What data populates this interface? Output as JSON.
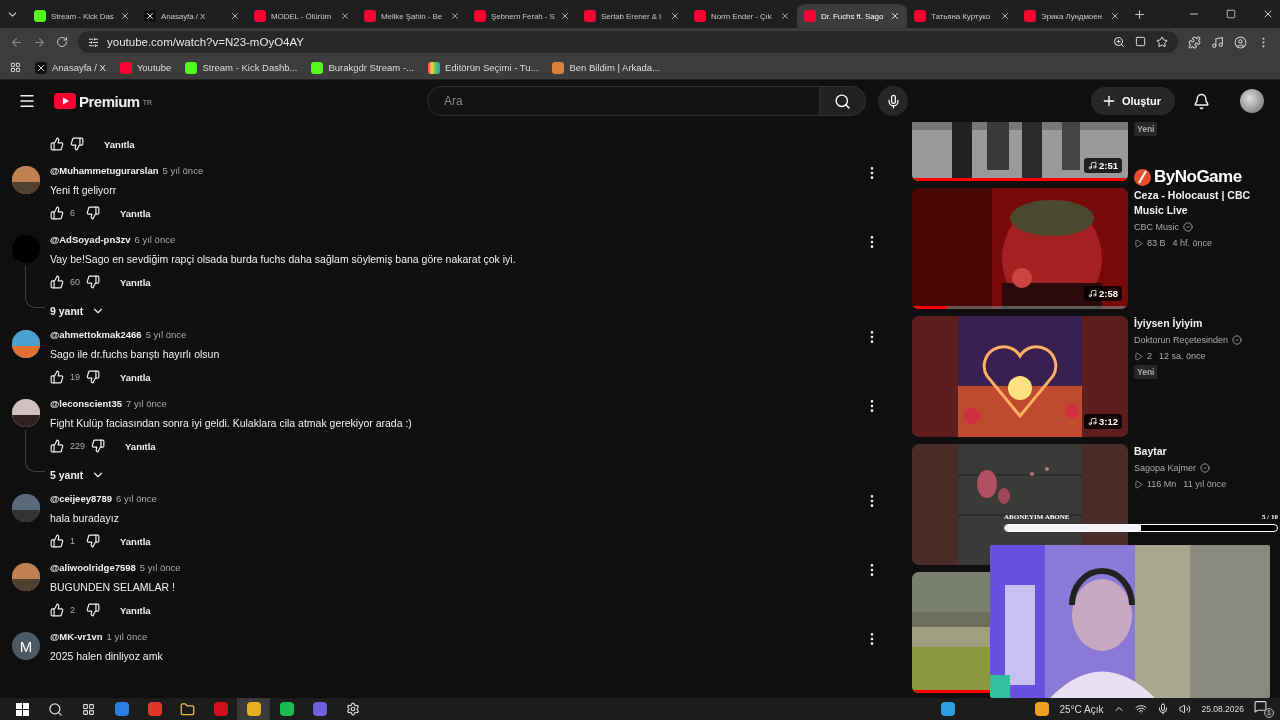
{
  "browser": {
    "tabs": [
      {
        "title": "Stream - Kick Das",
        "selected": false
      },
      {
        "title": "Anasayfa / X",
        "selected": false
      },
      {
        "title": "MODEL - Ölürüm",
        "selected": false
      },
      {
        "title": "Melike Şahin - Be",
        "selected": false
      },
      {
        "title": "Şebnem Ferah - S",
        "selected": false
      },
      {
        "title": "Sertab Erener & I",
        "selected": false
      },
      {
        "title": "Norm Ender - Çık",
        "selected": false
      },
      {
        "title": "Dr. Fuchs ft. Sago",
        "selected": true
      },
      {
        "title": "Татьяна Куртуко",
        "selected": false
      },
      {
        "title": "Эрика Лундмоен",
        "selected": false
      }
    ],
    "url": "youtube.com/watch?v=N23-mOyO4AY",
    "bookmarks": [
      "Anasayfa / X",
      "Youtube",
      "Stream - Kick Dashb...",
      "Burakgdr Stream -...",
      "Editörün Seçimi - Tu...",
      "Ben Bildim | Arkada..."
    ]
  },
  "header": {
    "logo": "Premium",
    "region": "TR",
    "search": {
      "placeholder": "Ara"
    },
    "create_button": "Oluştur"
  },
  "comments": [
    {
      "kind": "cut",
      "reply_button": "Yanıtla"
    },
    {
      "kind": "full",
      "author": "@Muhammetugurarslan",
      "time": "5 yıl önce",
      "text": "Yeni ft geliyorr",
      "likes": "6",
      "reply_button": "Yanıtla"
    },
    {
      "kind": "full",
      "avatar": {
        "kind": "blank"
      },
      "author": "@AdSoyad-pn3zv",
      "time": "6 yıl önce",
      "text": "Vay be!Sago en sevdiğim rapçi olsada burda fuchs daha sağlam söylemiş bana göre  nakarat çok iyi.",
      "likes": "60",
      "reply_button": "Yanıtla",
      "replies": "9 yanıt"
    },
    {
      "kind": "full",
      "author": "@ahmettokmak2466",
      "time": "5 yıl önce",
      "text": "Sago ile dr.fuchs barıştı hayırlı olsun",
      "likes": "19",
      "reply_button": "Yanıtla"
    },
    {
      "kind": "full",
      "author": "@leconscient35",
      "time": "7 yıl önce",
      "text": "Fight Kulüp faciasından sonra iyi geldi. Kulaklara cila atmak gerekiyor arada :)",
      "likes": "229",
      "reply_button": "Yanıtla",
      "replies": "5 yanıt"
    },
    {
      "kind": "full",
      "author": "@ceijeey8789",
      "time": "6 yıl önce",
      "text": "hala buradayız",
      "likes": "1",
      "reply_button": "Yanıtla"
    },
    {
      "kind": "full",
      "author": "@aliwoolridge7598",
      "time": "5 yıl önce",
      "text": "BUGUNDEN SELAMLAR !",
      "likes": "2",
      "reply_button": "Yanıtla"
    },
    {
      "kind": "full",
      "avatar": {
        "kind": "letter",
        "letter": "M"
      },
      "author": "@MK-vr1vn",
      "time": "1 yıl önce",
      "text": "2025 halen dinliyoz amk"
    }
  ],
  "related": [
    {
      "kind": "cut",
      "duration": "2:51",
      "badge": "Yeni",
      "level": 1
    },
    {
      "kind": "full",
      "duration": "2:58",
      "title": "Ceza - Holocaust | CBC Music Live",
      "channel": "CBC Music",
      "verified": true,
      "views": "83 B",
      "age": "4 hf. önce",
      "level": 0.16
    },
    {
      "kind": "full",
      "duration": "3:12",
      "title": "İyiysen İyiyim",
      "channel": "Doktorun Reçetesinden",
      "verified": true,
      "views": "2",
      "age": "12 sa. önce",
      "badge": "Yeni"
    },
    {
      "kind": "full",
      "title": "Baytar",
      "channel": "Sagopa Kajmer",
      "verified": true,
      "views": "116 Mn",
      "age": "11 yıl önce"
    },
    {
      "kind": "covered",
      "level": 0.36
    }
  ],
  "stream_overlay": {
    "logo": "ByNoGame",
    "goal_label": "ABONEYIM ABONE",
    "goal_count": "5 / 10",
    "level": 0.5
  },
  "taskbar": {
    "weather": "25°C Açık",
    "date": "25.08.2026",
    "notifications": "1"
  }
}
